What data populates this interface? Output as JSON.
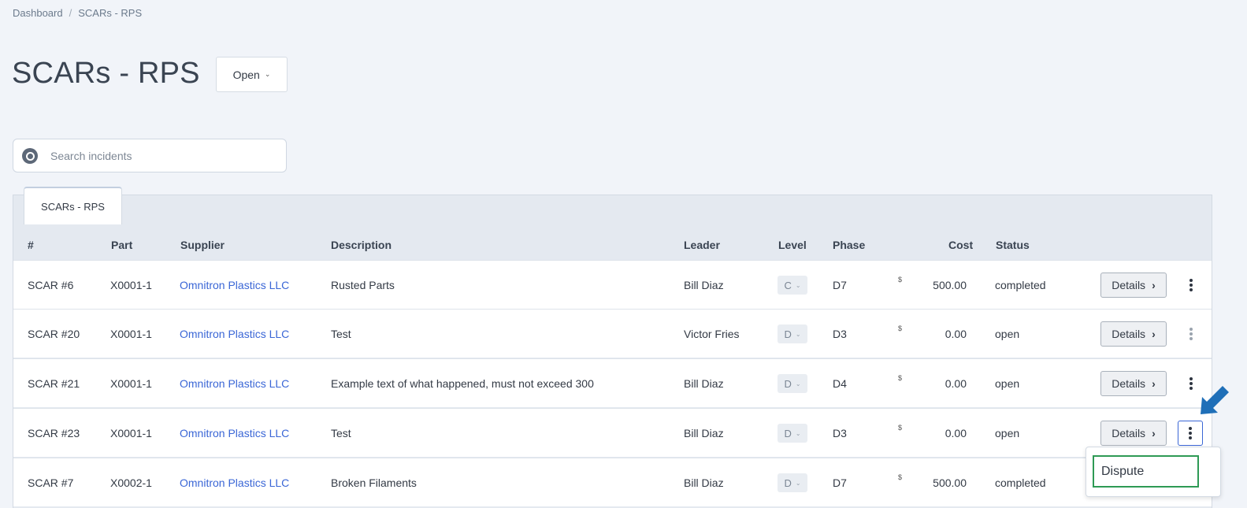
{
  "breadcrumb": {
    "home": "Dashboard",
    "current": "SCARs - RPS"
  },
  "page_title": "SCARs - RPS",
  "filter": {
    "value": "Open"
  },
  "search": {
    "placeholder": "Search incidents"
  },
  "tab_label": "SCARs - RPS",
  "columns": {
    "num": "#",
    "part": "Part",
    "supplier": "Supplier",
    "description": "Description",
    "leader": "Leader",
    "level": "Level",
    "phase": "Phase",
    "cost": "Cost",
    "status": "Status"
  },
  "rows": [
    {
      "num": "SCAR #6",
      "part": "X0001-1",
      "supplier": "Omnitron Plastics LLC",
      "description": "Rusted Parts",
      "leader": "Bill Diaz",
      "level": "C",
      "phase": "D7",
      "currency": "$",
      "cost": "500.00",
      "status": "completed",
      "details": "Details"
    },
    {
      "num": "SCAR #20",
      "part": "X0001-1",
      "supplier": "Omnitron Plastics LLC",
      "description": "Test",
      "leader": "Victor Fries",
      "level": "D",
      "phase": "D3",
      "currency": "$",
      "cost": "0.00",
      "status": "open",
      "details": "Details"
    },
    {
      "num": "SCAR #21",
      "part": "X0001-1",
      "supplier": "Omnitron Plastics LLC",
      "description": "Example text of what happened, must not exceed 300",
      "leader": "Bill Diaz",
      "level": "D",
      "phase": "D4",
      "currency": "$",
      "cost": "0.00",
      "status": "open",
      "details": "Details"
    },
    {
      "num": "SCAR #23",
      "part": "X0001-1",
      "supplier": "Omnitron Plastics LLC",
      "description": "Test",
      "leader": "Bill Diaz",
      "level": "D",
      "phase": "D3",
      "currency": "$",
      "cost": "0.00",
      "status": "open",
      "details": "Details"
    },
    {
      "num": "SCAR #7",
      "part": "X0002-1",
      "supplier": "Omnitron Plastics LLC",
      "description": "Broken Filaments",
      "leader": "Bill Diaz",
      "level": "D",
      "phase": "D7",
      "currency": "$",
      "cost": "500.00",
      "status": "completed",
      "details": "Details"
    }
  ],
  "row_menu": {
    "dispute": "Dispute"
  },
  "colors": {
    "accent": "#3a66d6",
    "highlight": "#2e9a55",
    "annotation_arrow": "#1f6fb8"
  }
}
